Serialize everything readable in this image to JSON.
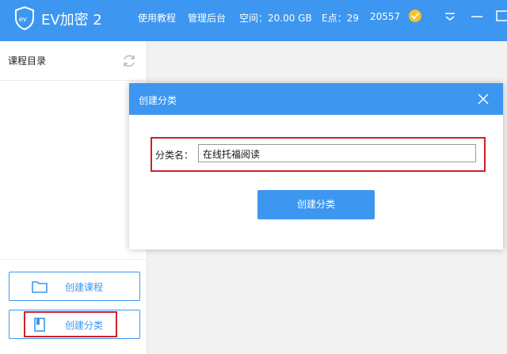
{
  "titlebar": {
    "app_title": "EV加密 2",
    "nav_tutorial": "使用教程",
    "nav_admin": "管理后台",
    "space": "空间：20.00 GB",
    "epoints": "E点：29",
    "user_id": "20557",
    "accent_color": "#3d96f0"
  },
  "sidebar": {
    "title": "课程目录",
    "create_course_label": "创建课程",
    "create_category_label": "创建分类"
  },
  "dialog": {
    "title": "创建分类",
    "field_label": "分类名：",
    "field_value": "在线托福阅读",
    "submit_label": "创建分类"
  },
  "highlight_color": "#d0202a"
}
